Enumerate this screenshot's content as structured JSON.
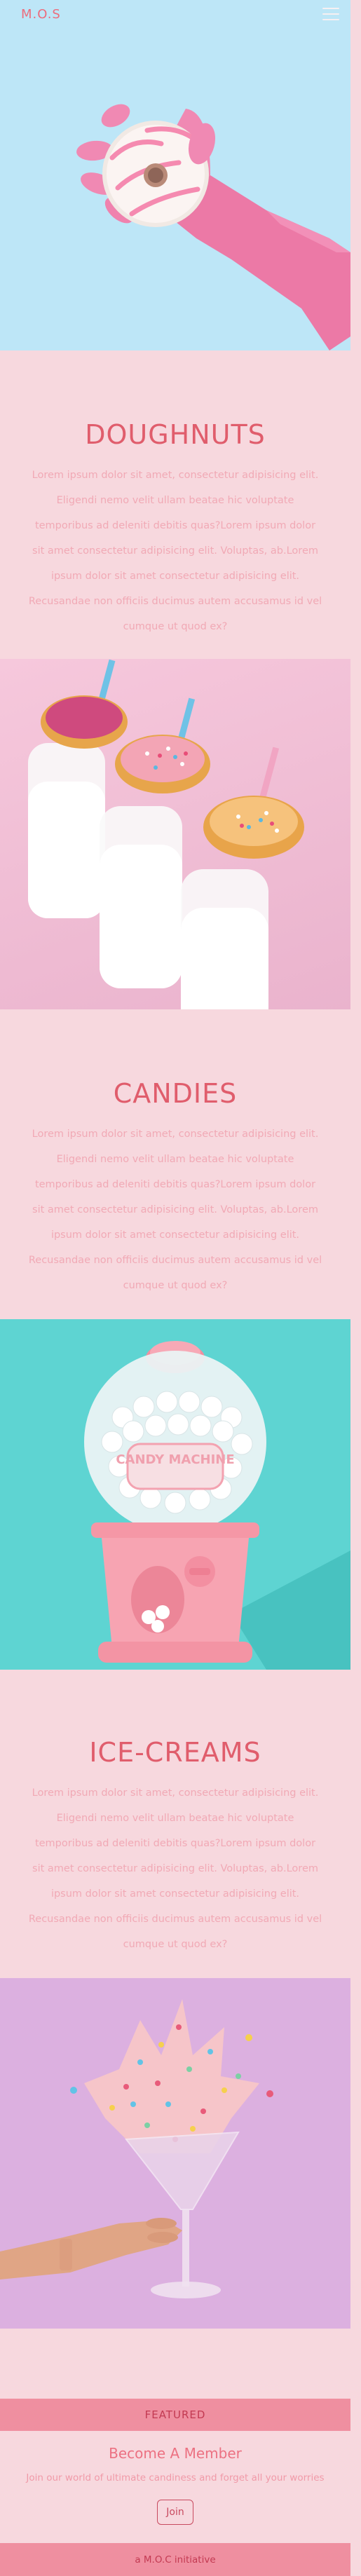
{
  "header": {
    "brand": "M.O.S",
    "menu_icon": "hamburger-menu-icon"
  },
  "hero": {
    "image": "pink-glove-holding-frosted-doughnut"
  },
  "sections": [
    {
      "title": "DOUGHNUTS",
      "body": "Lorem ipsum dolor sit amet, consectetur adipisicing elit. Eligendi nemo velit ullam beatae hic voluptate temporibus ad deleniti debitis quas?Lorem ipsum dolor sit amet consectetur adipisicing elit. Voluptas, ab.Lorem ipsum dolor sit amet consectetur adipisicing elit. Recusandae non officiis ducimus autem accusamus id vel cumque ut quod ex?",
      "image": "doughnuts-on-milk-bottles"
    },
    {
      "title": "CANDIES",
      "body": "Lorem ipsum dolor sit amet, consectetur adipisicing elit. Eligendi nemo velit ullam beatae hic voluptate temporibus ad deleniti debitis quas?Lorem ipsum dolor sit amet consectetur adipisicing elit. Voluptas, ab.Lorem ipsum dolor sit amet consectetur adipisicing elit. Recusandae non officiis ducimus autem accusamus id vel cumque ut quod ex?",
      "image": "pink-candy-machine",
      "image_label": "CANDY MACHINE"
    },
    {
      "title": "ICE-CREAMS",
      "body": "Lorem ipsum dolor sit amet, consectetur adipisicing elit. Eligendi nemo velit ullam beatae hic voluptate temporibus ad deleniti debitis quas?Lorem ipsum dolor sit amet consectetur adipisicing elit. Voluptas, ab.Lorem ipsum dolor sit amet consectetur adipisicing elit. Recusandae non officiis ducimus autem accusamus id vel cumque ut quod ex?",
      "image": "hand-holding-glass-with-sprinkles"
    }
  ],
  "footer": {
    "featured_label": "FEATURED",
    "member_title": "Become A Member",
    "member_subtitle": "Join our world of ultimate candiness and forget all your worries",
    "join_label": "Join",
    "bottom_text": "a M.O.C initiative"
  },
  "colors": {
    "page_bg": "#f7d8de",
    "accent": "#e05d6c",
    "body_text": "#f1a9b5",
    "footer_bar": "#ef8fa0"
  }
}
